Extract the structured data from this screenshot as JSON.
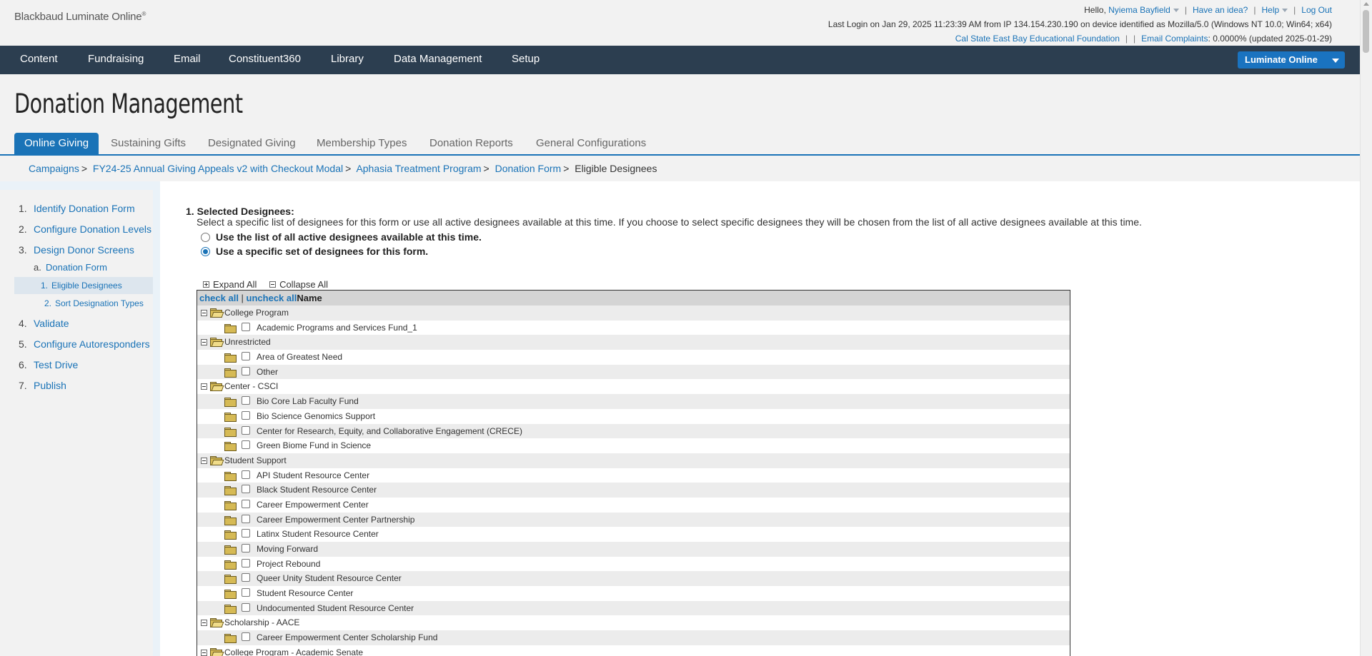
{
  "header": {
    "logo": "Blackbaud Luminate Online",
    "logo_mark": "®",
    "greeting": "Hello,",
    "user_name": "Nyiema Bayfield",
    "have_idea": "Have an idea?",
    "help": "Help",
    "logout": "Log Out",
    "last_login": "Last Login on Jan 29, 2025 11:23:39 AM from IP 134.154.230.190 on device identified as Mozilla/5.0 (Windows NT 10.0; Win64; x64)",
    "org_name": "Cal State East Bay Educational Foundation",
    "email_complaints_label": "Email Complaints",
    "email_complaints_value": ": 0.0000% (updated 2025-01-29)"
  },
  "nav": {
    "items": [
      "Content",
      "Fundraising",
      "Email",
      "Constituent360",
      "Library",
      "Data Management",
      "Setup"
    ],
    "product_button": "Luminate Online"
  },
  "page": {
    "title": "Donation Management",
    "tabs": [
      "Online Giving",
      "Sustaining Gifts",
      "Designated Giving",
      "Membership Types",
      "Donation Reports",
      "General Configurations"
    ],
    "breadcrumb": [
      "Campaigns",
      "FY24-25 Annual Giving Appeals v2 with Checkout Modal",
      "Aphasia Treatment Program",
      "Donation Form"
    ],
    "breadcrumb_current": "Eligible Designees"
  },
  "sidebar": {
    "steps": [
      {
        "num": "1.",
        "label": "Identify Donation Form"
      },
      {
        "num": "2.",
        "label": "Configure Donation Levels"
      },
      {
        "num": "3.",
        "label": "Design Donor Screens"
      },
      {
        "num": "a.",
        "label": "Donation Form"
      },
      {
        "num": "1.",
        "label": "Eligible Designees"
      },
      {
        "num": "2.",
        "label": "Sort Designation Types"
      },
      {
        "num": "4.",
        "label": "Validate"
      },
      {
        "num": "5.",
        "label": "Configure Autoresponders"
      },
      {
        "num": "6.",
        "label": "Test Drive"
      },
      {
        "num": "7.",
        "label": "Publish"
      }
    ]
  },
  "section": {
    "title": "1. Selected Designees:",
    "description": "Select a specific list of designees for this form or use all active designees available at this time. If you choose to select specific designees they will be chosen from the list of all active designees available at this time.",
    "radio_all": "Use the list of all active designees available at this time.",
    "radio_specific": "Use a specific set of designees for this form.",
    "selected_option": "specific",
    "expand_all": "Expand All",
    "collapse_all": "Collapse All",
    "check_all": "check all",
    "separator": " | ",
    "uncheck_all": "uncheck all",
    "name_header": "Name"
  },
  "tree": [
    {
      "type": "group",
      "label": "College Program"
    },
    {
      "type": "item",
      "label": "Academic Programs and Services Fund_1"
    },
    {
      "type": "group",
      "label": "Unrestricted"
    },
    {
      "type": "item",
      "label": "Area of Greatest Need"
    },
    {
      "type": "item",
      "label": "Other"
    },
    {
      "type": "group",
      "label": "Center - CSCI"
    },
    {
      "type": "item",
      "label": "Bio Core Lab Faculty Fund"
    },
    {
      "type": "item",
      "label": "Bio Science Genomics Support"
    },
    {
      "type": "item",
      "label": "Center for Research, Equity, and Collaborative Engagement (CRECE)"
    },
    {
      "type": "item",
      "label": "Green Biome Fund in Science"
    },
    {
      "type": "group",
      "label": "Student Support"
    },
    {
      "type": "item",
      "label": "API Student Resource Center"
    },
    {
      "type": "item",
      "label": "Black Student Resource Center"
    },
    {
      "type": "item",
      "label": "Career Empowerment Center"
    },
    {
      "type": "item",
      "label": "Career Empowerment Center Partnership"
    },
    {
      "type": "item",
      "label": "Latinx Student Resource Center"
    },
    {
      "type": "item",
      "label": "Moving Forward"
    },
    {
      "type": "item",
      "label": "Project Rebound"
    },
    {
      "type": "item",
      "label": "Queer Unity Student Resource Center"
    },
    {
      "type": "item",
      "label": "Student Resource Center"
    },
    {
      "type": "item",
      "label": "Undocumented Student Resource Center"
    },
    {
      "type": "group",
      "label": "Scholarship - AACE"
    },
    {
      "type": "item",
      "label": "Career Empowerment Center Scholarship Fund"
    },
    {
      "type": "group",
      "label": "College Program - Academic Senate"
    }
  ]
}
